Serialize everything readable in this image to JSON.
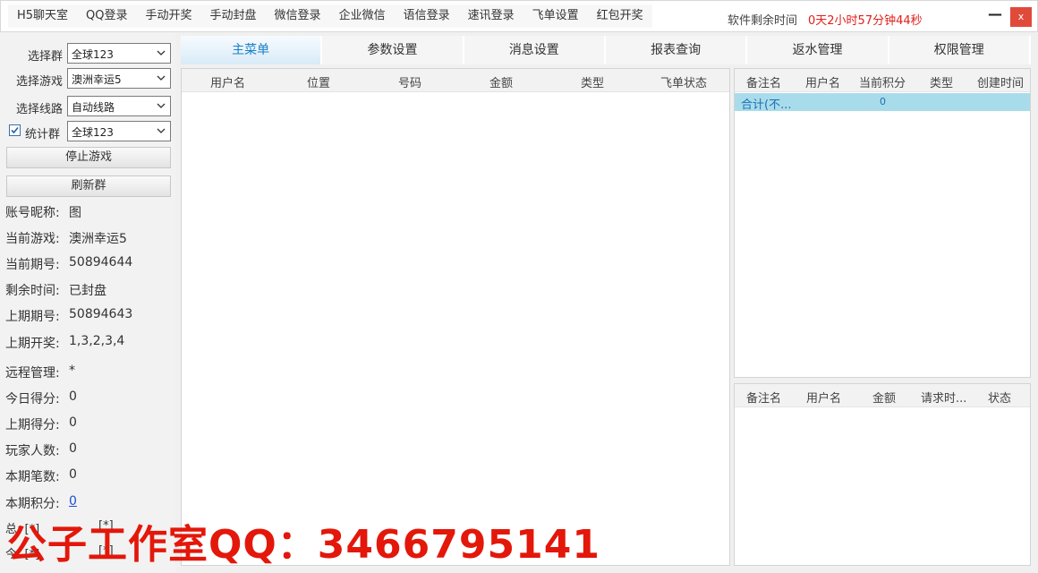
{
  "menu": [
    "H5聊天室",
    "QQ登录",
    "手动开奖",
    "手动封盘",
    "微信登录",
    "企业微信",
    "语信登录",
    "速讯登录",
    "飞单设置",
    "红包开奖"
  ],
  "remaining": {
    "label": "软件剩余时间",
    "value": "0天2小时57分钟44秒"
  },
  "window": {
    "minimize": "—",
    "close": "x"
  },
  "left": {
    "select_group": {
      "label": "选择群",
      "value": "全球123"
    },
    "select_game": {
      "label": "选择游戏",
      "value": "澳洲幸运5"
    },
    "select_route": {
      "label": "选择线路",
      "value": "自动线路"
    },
    "stat_group": {
      "label": "统计群",
      "value": "全球123",
      "checked": true
    },
    "stop_button": "停止游戏",
    "refresh_button": "刷新群",
    "info": [
      {
        "k": "账号昵称:",
        "v": "图"
      },
      {
        "k": "当前游戏:",
        "v": "澳洲幸运5"
      },
      {
        "k": "当前期号:",
        "v": "50894644"
      },
      {
        "k": "剩余时间:",
        "v": "已封盘"
      },
      {
        "k": "上期期号:",
        "v": "50894643"
      },
      {
        "k": "上期开奖:",
        "v": "1,3,2,3,4"
      },
      {
        "k": "远程管理:",
        "v": "*"
      },
      {
        "k": "今日得分:",
        "v": "0"
      },
      {
        "k": "上期得分:",
        "v": "0"
      },
      {
        "k": "玩家人数:",
        "v": "0"
      },
      {
        "k": "本期笔数:",
        "v": "0"
      },
      {
        "k": "本期积分:",
        "v": "0"
      }
    ],
    "ghost": {
      "total_label": "总: [*]",
      "total_value": "[*]",
      "today_label": "今: [*]",
      "today_value": "[*]"
    }
  },
  "tabs": [
    "主菜单",
    "参数设置",
    "消息设置",
    "报表查询",
    "返水管理",
    "权限管理"
  ],
  "main_table": {
    "columns": [
      "用户名",
      "位置",
      "号码",
      "金额",
      "类型",
      "飞单状态"
    ]
  },
  "right_top_table": {
    "columns": [
      "备注名",
      "用户名",
      "当前积分",
      "类型",
      "创建时间"
    ],
    "summary": {
      "name": "合计(不...",
      "points": "0"
    }
  },
  "right_bottom_table": {
    "columns": [
      "备注名",
      "用户名",
      "金额",
      "请求时...",
      "状态"
    ]
  },
  "watermark": "公子工作室QQ：3466795141"
}
